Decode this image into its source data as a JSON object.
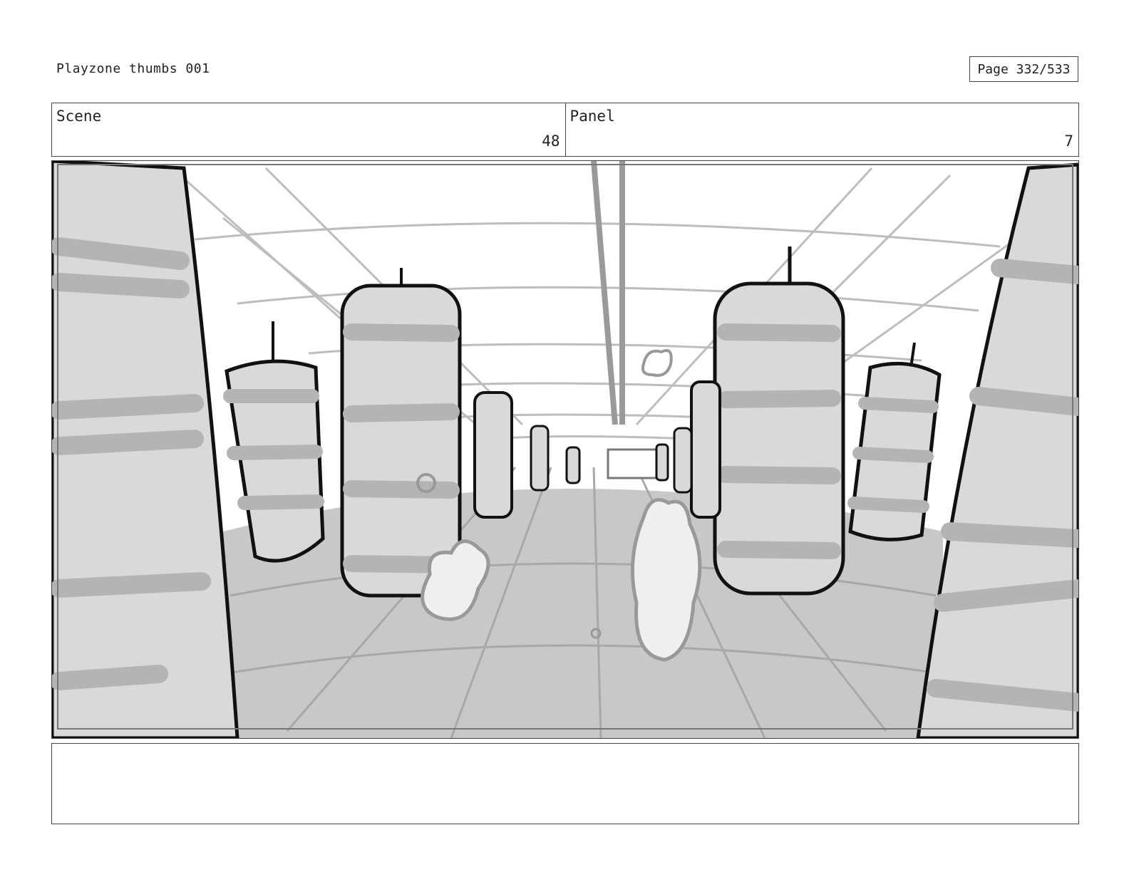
{
  "header": {
    "doc_title": "Playzone thumbs 001",
    "page_label": "Page 332/533"
  },
  "scene": {
    "label": "Scene",
    "value": "48"
  },
  "panel": {
    "label": "Panel",
    "value": "7"
  },
  "artwork": {
    "subject": "storyboard-sketch",
    "palette": {
      "ink": "#111111",
      "mid_gray": "#b4b4b4",
      "light_gray": "#d6d6d6",
      "floor_gray": "#c8c8c8",
      "paper": "#ffffff"
    }
  },
  "notes": {
    "text": ""
  }
}
